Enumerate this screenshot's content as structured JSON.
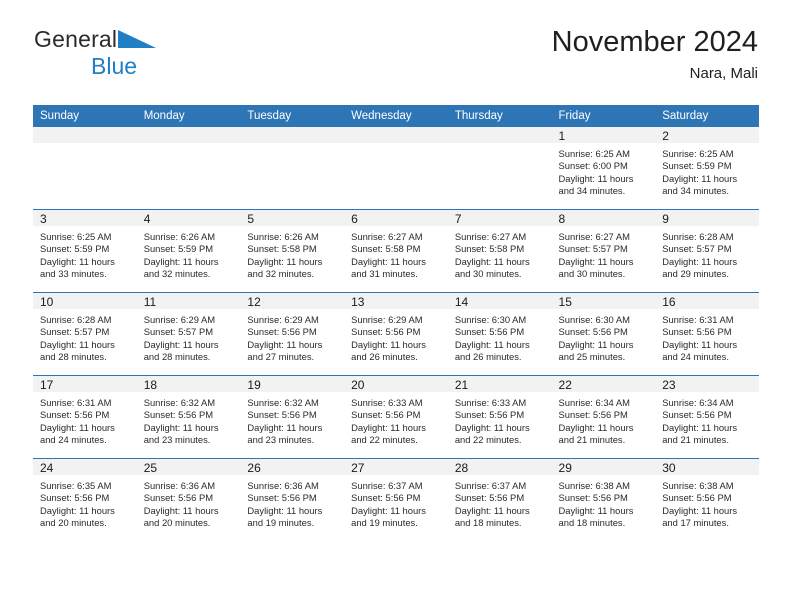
{
  "brand": {
    "name_part1": "General",
    "name_part2": "Blue",
    "logo_icon": "triangle-flag-icon"
  },
  "header": {
    "month_title": "November 2024",
    "location": "Nara, Mali"
  },
  "colors": {
    "header_blue": "#2e75b6",
    "brand_blue": "#1f7fc4",
    "daynum_band": "#f2f2f2",
    "cell_bg": "#ffffff",
    "text": "#2a2a2a"
  },
  "calendar": {
    "weekday_headers": [
      "Sunday",
      "Monday",
      "Tuesday",
      "Wednesday",
      "Thursday",
      "Friday",
      "Saturday"
    ],
    "weeks": [
      [
        {
          "day": "",
          "lines": []
        },
        {
          "day": "",
          "lines": []
        },
        {
          "day": "",
          "lines": []
        },
        {
          "day": "",
          "lines": []
        },
        {
          "day": "",
          "lines": []
        },
        {
          "day": "1",
          "lines": [
            "Sunrise: 6:25 AM",
            "Sunset: 6:00 PM",
            "Daylight: 11 hours",
            "and 34 minutes."
          ]
        },
        {
          "day": "2",
          "lines": [
            "Sunrise: 6:25 AM",
            "Sunset: 5:59 PM",
            "Daylight: 11 hours",
            "and 34 minutes."
          ]
        }
      ],
      [
        {
          "day": "3",
          "lines": [
            "Sunrise: 6:25 AM",
            "Sunset: 5:59 PM",
            "Daylight: 11 hours",
            "and 33 minutes."
          ]
        },
        {
          "day": "4",
          "lines": [
            "Sunrise: 6:26 AM",
            "Sunset: 5:59 PM",
            "Daylight: 11 hours",
            "and 32 minutes."
          ]
        },
        {
          "day": "5",
          "lines": [
            "Sunrise: 6:26 AM",
            "Sunset: 5:58 PM",
            "Daylight: 11 hours",
            "and 32 minutes."
          ]
        },
        {
          "day": "6",
          "lines": [
            "Sunrise: 6:27 AM",
            "Sunset: 5:58 PM",
            "Daylight: 11 hours",
            "and 31 minutes."
          ]
        },
        {
          "day": "7",
          "lines": [
            "Sunrise: 6:27 AM",
            "Sunset: 5:58 PM",
            "Daylight: 11 hours",
            "and 30 minutes."
          ]
        },
        {
          "day": "8",
          "lines": [
            "Sunrise: 6:27 AM",
            "Sunset: 5:57 PM",
            "Daylight: 11 hours",
            "and 30 minutes."
          ]
        },
        {
          "day": "9",
          "lines": [
            "Sunrise: 6:28 AM",
            "Sunset: 5:57 PM",
            "Daylight: 11 hours",
            "and 29 minutes."
          ]
        }
      ],
      [
        {
          "day": "10",
          "lines": [
            "Sunrise: 6:28 AM",
            "Sunset: 5:57 PM",
            "Daylight: 11 hours",
            "and 28 minutes."
          ]
        },
        {
          "day": "11",
          "lines": [
            "Sunrise: 6:29 AM",
            "Sunset: 5:57 PM",
            "Daylight: 11 hours",
            "and 28 minutes."
          ]
        },
        {
          "day": "12",
          "lines": [
            "Sunrise: 6:29 AM",
            "Sunset: 5:56 PM",
            "Daylight: 11 hours",
            "and 27 minutes."
          ]
        },
        {
          "day": "13",
          "lines": [
            "Sunrise: 6:29 AM",
            "Sunset: 5:56 PM",
            "Daylight: 11 hours",
            "and 26 minutes."
          ]
        },
        {
          "day": "14",
          "lines": [
            "Sunrise: 6:30 AM",
            "Sunset: 5:56 PM",
            "Daylight: 11 hours",
            "and 26 minutes."
          ]
        },
        {
          "day": "15",
          "lines": [
            "Sunrise: 6:30 AM",
            "Sunset: 5:56 PM",
            "Daylight: 11 hours",
            "and 25 minutes."
          ]
        },
        {
          "day": "16",
          "lines": [
            "Sunrise: 6:31 AM",
            "Sunset: 5:56 PM",
            "Daylight: 11 hours",
            "and 24 minutes."
          ]
        }
      ],
      [
        {
          "day": "17",
          "lines": [
            "Sunrise: 6:31 AM",
            "Sunset: 5:56 PM",
            "Daylight: 11 hours",
            "and 24 minutes."
          ]
        },
        {
          "day": "18",
          "lines": [
            "Sunrise: 6:32 AM",
            "Sunset: 5:56 PM",
            "Daylight: 11 hours",
            "and 23 minutes."
          ]
        },
        {
          "day": "19",
          "lines": [
            "Sunrise: 6:32 AM",
            "Sunset: 5:56 PM",
            "Daylight: 11 hours",
            "and 23 minutes."
          ]
        },
        {
          "day": "20",
          "lines": [
            "Sunrise: 6:33 AM",
            "Sunset: 5:56 PM",
            "Daylight: 11 hours",
            "and 22 minutes."
          ]
        },
        {
          "day": "21",
          "lines": [
            "Sunrise: 6:33 AM",
            "Sunset: 5:56 PM",
            "Daylight: 11 hours",
            "and 22 minutes."
          ]
        },
        {
          "day": "22",
          "lines": [
            "Sunrise: 6:34 AM",
            "Sunset: 5:56 PM",
            "Daylight: 11 hours",
            "and 21 minutes."
          ]
        },
        {
          "day": "23",
          "lines": [
            "Sunrise: 6:34 AM",
            "Sunset: 5:56 PM",
            "Daylight: 11 hours",
            "and 21 minutes."
          ]
        }
      ],
      [
        {
          "day": "24",
          "lines": [
            "Sunrise: 6:35 AM",
            "Sunset: 5:56 PM",
            "Daylight: 11 hours",
            "and 20 minutes."
          ]
        },
        {
          "day": "25",
          "lines": [
            "Sunrise: 6:36 AM",
            "Sunset: 5:56 PM",
            "Daylight: 11 hours",
            "and 20 minutes."
          ]
        },
        {
          "day": "26",
          "lines": [
            "Sunrise: 6:36 AM",
            "Sunset: 5:56 PM",
            "Daylight: 11 hours",
            "and 19 minutes."
          ]
        },
        {
          "day": "27",
          "lines": [
            "Sunrise: 6:37 AM",
            "Sunset: 5:56 PM",
            "Daylight: 11 hours",
            "and 19 minutes."
          ]
        },
        {
          "day": "28",
          "lines": [
            "Sunrise: 6:37 AM",
            "Sunset: 5:56 PM",
            "Daylight: 11 hours",
            "and 18 minutes."
          ]
        },
        {
          "day": "29",
          "lines": [
            "Sunrise: 6:38 AM",
            "Sunset: 5:56 PM",
            "Daylight: 11 hours",
            "and 18 minutes."
          ]
        },
        {
          "day": "30",
          "lines": [
            "Sunrise: 6:38 AM",
            "Sunset: 5:56 PM",
            "Daylight: 11 hours",
            "and 17 minutes."
          ]
        }
      ]
    ]
  }
}
